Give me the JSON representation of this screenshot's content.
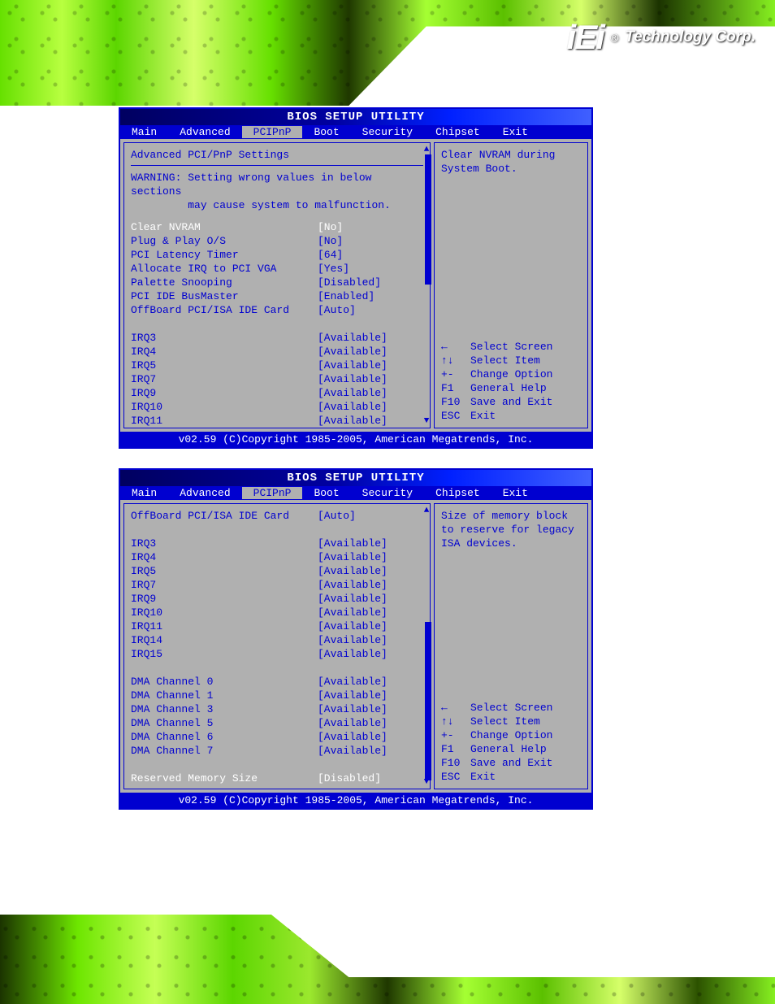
{
  "brand": {
    "logo": "iEi",
    "reg": "®",
    "name": "Technology Corp."
  },
  "bios": {
    "title": "BIOS SETUP UTILITY",
    "tabs": [
      "Main",
      "Advanced",
      "PCIPnP",
      "Boot",
      "Security",
      "Chipset",
      "Exit"
    ],
    "active_tab": "PCIPnP",
    "footer": "v02.59 (C)Copyright 1985-2005, American Megatrends, Inc.",
    "help_keys": [
      {
        "key": "←",
        "text": "Select Screen"
      },
      {
        "key": "↑↓",
        "text": "Select Item"
      },
      {
        "key": "+-",
        "text": "Change Option"
      },
      {
        "key": "F1",
        "text": "General Help"
      },
      {
        "key": "F10",
        "text": "Save and Exit"
      },
      {
        "key": "ESC",
        "text": "Exit"
      }
    ]
  },
  "panel1": {
    "heading": "Advanced PCI/PnP Settings",
    "warning1": "WARNING: Setting wrong values in below sections",
    "warning2": "         may cause system to malfunction.",
    "selected": {
      "label": "Clear NVRAM",
      "value": "[No]"
    },
    "rows": [
      {
        "label": "Plug & Play O/S",
        "value": "[No]"
      },
      {
        "label": "PCI Latency Timer",
        "value": "[64]"
      },
      {
        "label": "Allocate IRQ to PCI VGA",
        "value": "[Yes]"
      },
      {
        "label": "Palette Snooping",
        "value": "[Disabled]"
      },
      {
        "label": "PCI IDE BusMaster",
        "value": "[Enabled]"
      },
      {
        "label": "OffBoard PCI/ISA IDE Card",
        "value": "[Auto]"
      }
    ],
    "irqs": [
      {
        "label": "IRQ3",
        "value": "[Available]"
      },
      {
        "label": "IRQ4",
        "value": "[Available]"
      },
      {
        "label": "IRQ5",
        "value": "[Available]"
      },
      {
        "label": "IRQ7",
        "value": "[Available]"
      },
      {
        "label": "IRQ9",
        "value": "[Available]"
      },
      {
        "label": "IRQ10",
        "value": "[Available]"
      },
      {
        "label": "IRQ11",
        "value": "[Available]"
      }
    ],
    "help1": "Clear NVRAM during",
    "help2": "System Boot."
  },
  "panel2": {
    "top": {
      "label": "OffBoard PCI/ISA IDE Card",
      "value": "[Auto]"
    },
    "irqs": [
      {
        "label": "IRQ3",
        "value": "[Available]"
      },
      {
        "label": "IRQ4",
        "value": "[Available]"
      },
      {
        "label": "IRQ5",
        "value": "[Available]"
      },
      {
        "label": "IRQ7",
        "value": "[Available]"
      },
      {
        "label": "IRQ9",
        "value": "[Available]"
      },
      {
        "label": "IRQ10",
        "value": "[Available]"
      },
      {
        "label": "IRQ11",
        "value": "[Available]"
      },
      {
        "label": "IRQ14",
        "value": "[Available]"
      },
      {
        "label": "IRQ15",
        "value": "[Available]"
      }
    ],
    "dmas": [
      {
        "label": "DMA Channel 0",
        "value": "[Available]"
      },
      {
        "label": "DMA Channel 1",
        "value": "[Available]"
      },
      {
        "label": "DMA Channel 3",
        "value": "[Available]"
      },
      {
        "label": "DMA Channel 5",
        "value": "[Available]"
      },
      {
        "label": "DMA Channel 6",
        "value": "[Available]"
      },
      {
        "label": "DMA Channel 7",
        "value": "[Available]"
      }
    ],
    "selected": {
      "label": "Reserved Memory Size",
      "value": "[Disabled]"
    },
    "help1": "Size of memory block",
    "help2": "to reserve for legacy",
    "help3": "ISA devices."
  }
}
